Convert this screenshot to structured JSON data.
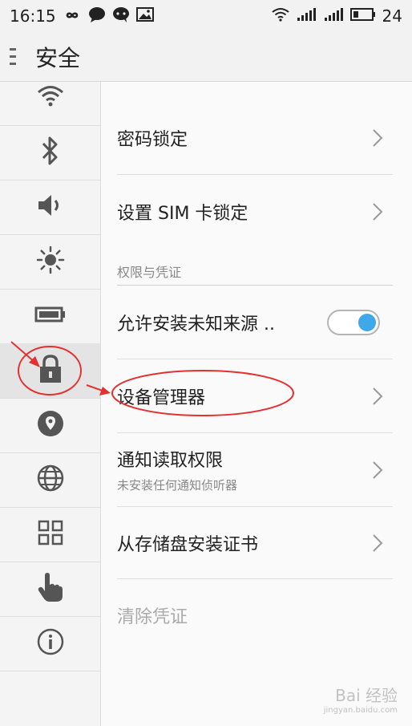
{
  "status_bar": {
    "time": "16:15",
    "battery": "24",
    "left_icons": [
      "infinity-icon",
      "chat-bubble-icon",
      "wechat-icon",
      "image-icon"
    ],
    "right_icons": [
      "wifi-icon",
      "signal-icon",
      "signal-icon",
      "battery-icon"
    ]
  },
  "app_bar": {
    "title": "安全",
    "menu_icon": "drawer-menu-icon"
  },
  "sidebar": {
    "items": [
      {
        "icon": "wifi-icon",
        "active": false
      },
      {
        "icon": "bluetooth-icon",
        "active": false
      },
      {
        "icon": "volume-icon",
        "active": false
      },
      {
        "icon": "brightness-icon",
        "active": false
      },
      {
        "icon": "battery-icon",
        "active": false
      },
      {
        "icon": "lock-icon",
        "active": true
      },
      {
        "icon": "location-icon",
        "active": false
      },
      {
        "icon": "globe-icon",
        "active": false
      },
      {
        "icon": "apps-grid-icon",
        "active": false
      },
      {
        "icon": "hand-pointer-icon",
        "active": false
      },
      {
        "icon": "info-icon",
        "active": false
      }
    ]
  },
  "settings": {
    "password_lock": "密码锁定",
    "sim_lock": "设置 SIM 卡锁定",
    "section_header": "权限与凭证",
    "unknown_sources": "允许安装未知来源 ..",
    "unknown_sources_enabled": true,
    "device_admin": "设备管理器",
    "notification_access": "通知读取权限",
    "notification_access_sub": "未安装任何通知侦听器",
    "install_from_storage": "从存储盘安装证书",
    "clear_credentials": "清除凭证"
  },
  "colors": {
    "accent": "#3fa8ea",
    "annotation": "#e53030",
    "disabled_text": "#aaaaaa"
  },
  "watermark": {
    "text": "Bai 经验",
    "sub": "jingyan.baidu.com"
  }
}
